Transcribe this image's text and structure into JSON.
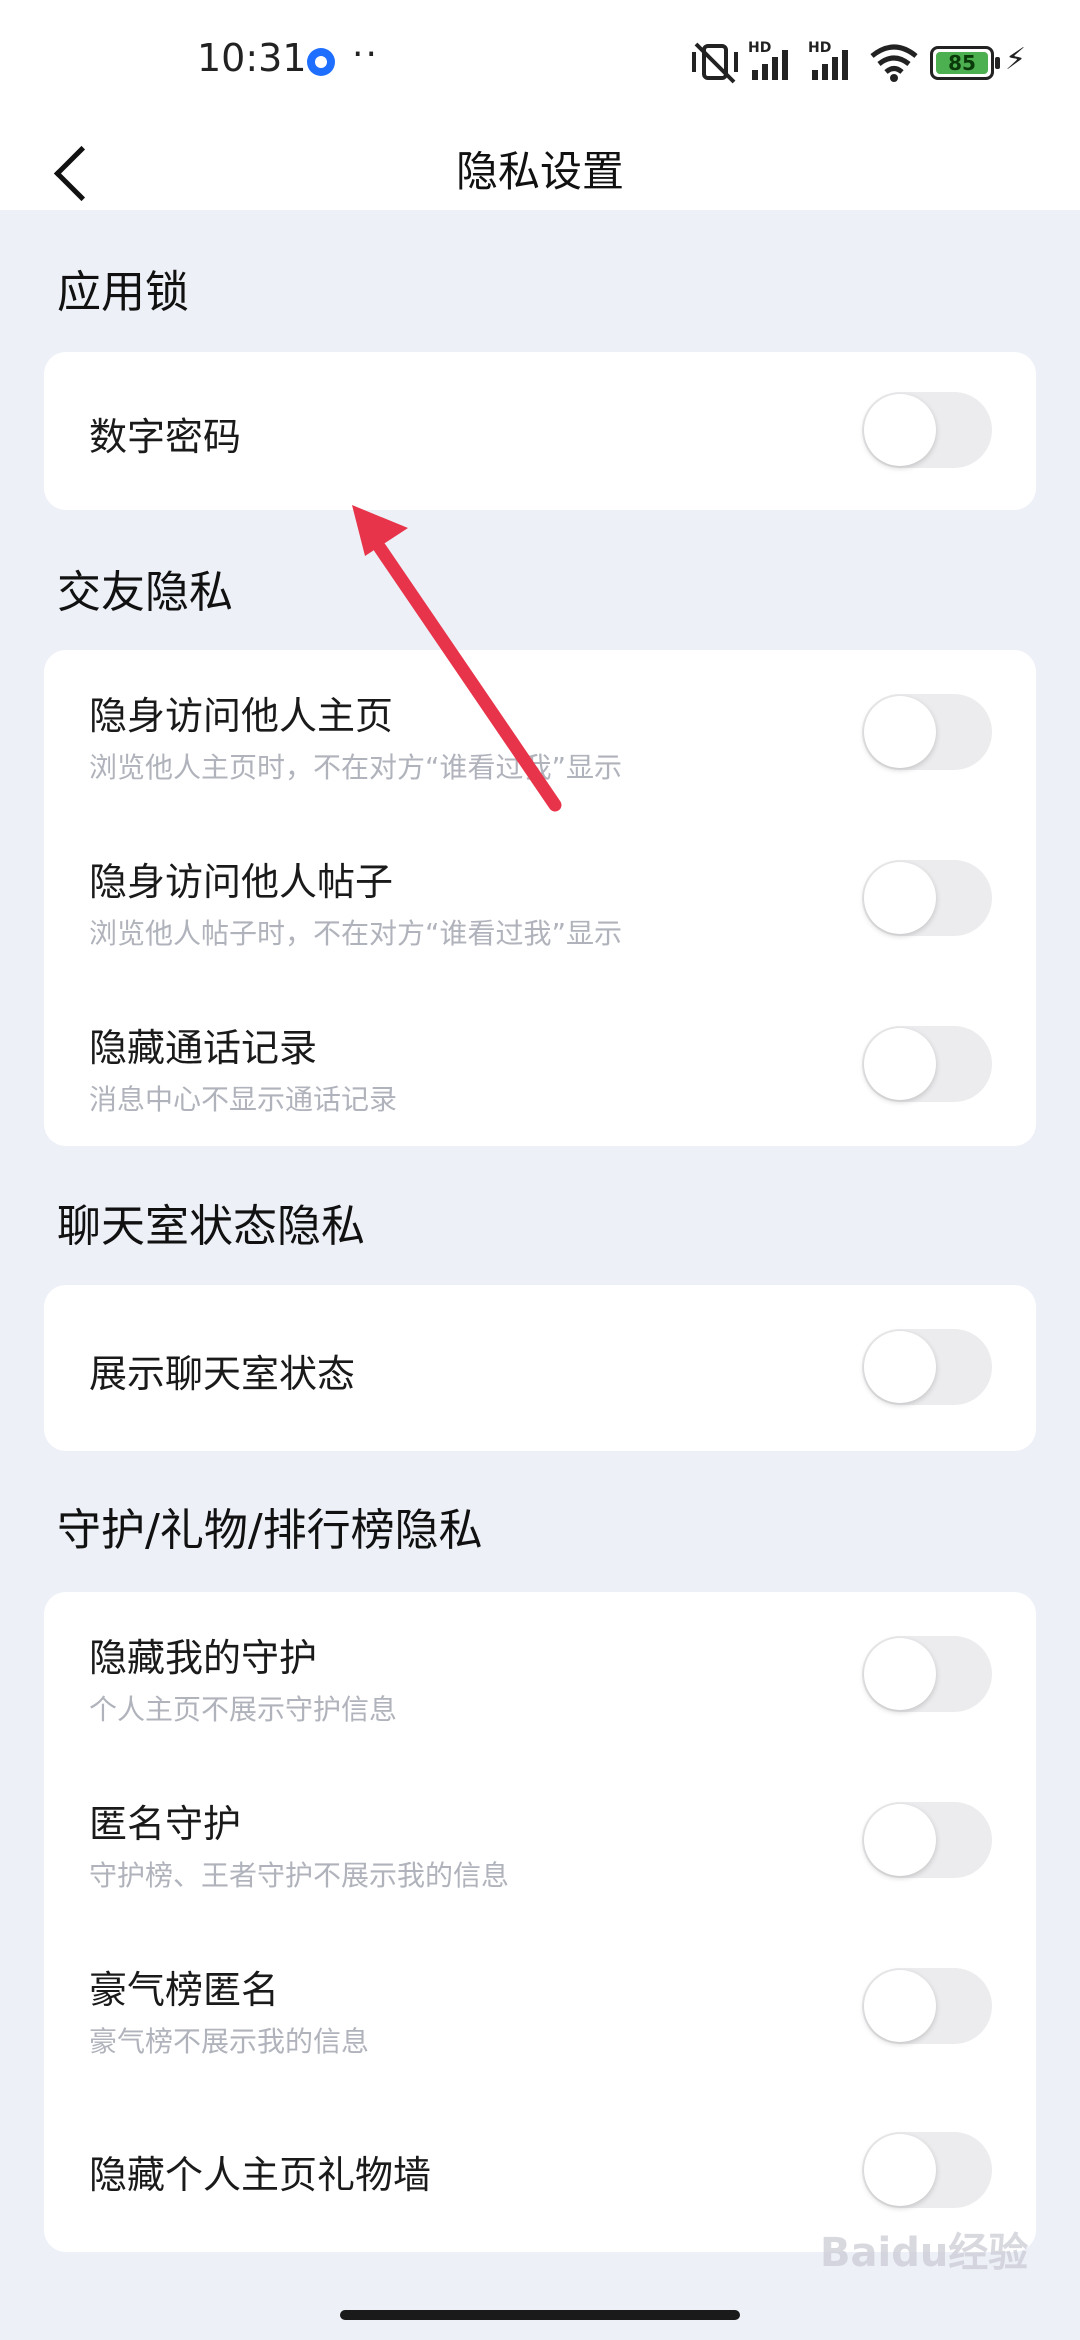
{
  "status_bar": {
    "time": "10:31",
    "more": "··",
    "network_label_1": "HD",
    "network_label_2": "HD",
    "battery": "85"
  },
  "header": {
    "title": "隐私设置"
  },
  "sections": [
    {
      "title": "应用锁",
      "items": [
        {
          "title": "数字密码",
          "subtitle": "",
          "enabled": false
        }
      ]
    },
    {
      "title": "交友隐私",
      "items": [
        {
          "title": "隐身访问他人主页",
          "subtitle": "浏览他人主页时，不在对方“谁看过我”显示",
          "enabled": false
        },
        {
          "title": "隐身访问他人帖子",
          "subtitle": "浏览他人帖子时，不在对方“谁看过我”显示",
          "enabled": false
        },
        {
          "title": "隐藏通话记录",
          "subtitle": "消息中心不显示通话记录",
          "enabled": false
        }
      ]
    },
    {
      "title": "聊天室状态隐私",
      "items": [
        {
          "title": "展示聊天室状态",
          "subtitle": "",
          "enabled": false
        }
      ]
    },
    {
      "title": "守护/礼物/排行榜隐私",
      "items": [
        {
          "title": "隐藏我的守护",
          "subtitle": "个人主页不展示守护信息",
          "enabled": false
        },
        {
          "title": "匿名守护",
          "subtitle": "守护榜、王者守护不展示我的信息",
          "enabled": false
        },
        {
          "title": "豪气榜匿名",
          "subtitle": "豪气榜不展示我的信息",
          "enabled": false
        },
        {
          "title": "隐藏个人主页礼物墙",
          "subtitle": "",
          "enabled": false
        }
      ]
    }
  ],
  "colors": {
    "page_background": "#edf0f7",
    "card_background": "#ffffff",
    "toggle_off": "#ececee",
    "annotation_arrow": "#e8344a"
  },
  "watermark": "Baidu经验"
}
